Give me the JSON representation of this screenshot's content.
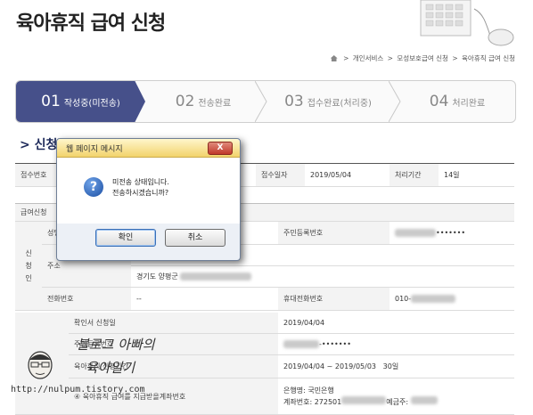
{
  "page": {
    "title": "육아휴직 급여 신청"
  },
  "breadcrumb": [
    "개인서비스",
    "모성보호급여 신청",
    "육아휴직 급여 신청"
  ],
  "steps": [
    {
      "num": "01",
      "label": "작성중(미전송)",
      "active": true
    },
    {
      "num": "02",
      "label": "전송완료",
      "active": false
    },
    {
      "num": "03",
      "label": "접수완료(처리중)",
      "active": false
    },
    {
      "num": "04",
      "label": "처리완료",
      "active": false
    }
  ],
  "section": {
    "title": "신청"
  },
  "receipt": {
    "no_label": "접수번호",
    "date_label": "접수일자",
    "date_value": "2019/05/04",
    "period_label": "처리기간",
    "period_value": "14일"
  },
  "info": {
    "group_label": "급여신청",
    "applicant_label": "신\n청\n인",
    "name_label": "성명",
    "rrn_label": "주민등록번호",
    "rrn_value": "•••••••",
    "address_label": "주소",
    "address_value": "경기도 양평군",
    "phone_label": "전화번호",
    "phone_value": "--",
    "mobile_label": "휴대전화번호",
    "mobile_value": "010-"
  },
  "confirm": {
    "date_label": "확인서 신청일",
    "date_value": "2019/04/04",
    "spouse_rrn_label": "주민등록번호",
    "spouse_rrn_value": "-•••••••",
    "leave_period_label": "육아휴직 신청기간",
    "leave_period_value": "2019/04/04 ~ 2019/05/03",
    "leave_days": "30일",
    "account_label": "④ 육아휴직 급여를 지급받을계좌번호",
    "bank_label": "은행명:",
    "bank_value": "국민은행",
    "account_no_label": "계좌번호:",
    "account_no_value": "272501",
    "holder_label": "예금주:"
  },
  "dialog": {
    "title": "웹 페이지 메시지",
    "close": "X",
    "message_line1": "미전송 상태입니다.",
    "message_line2": "전송하시겠습니까?",
    "ok": "확인",
    "cancel": "취소"
  },
  "watermark": {
    "line1": "블로그 아빠의",
    "line2": "육아일기",
    "url": "http://nulpum.tistory.com"
  }
}
